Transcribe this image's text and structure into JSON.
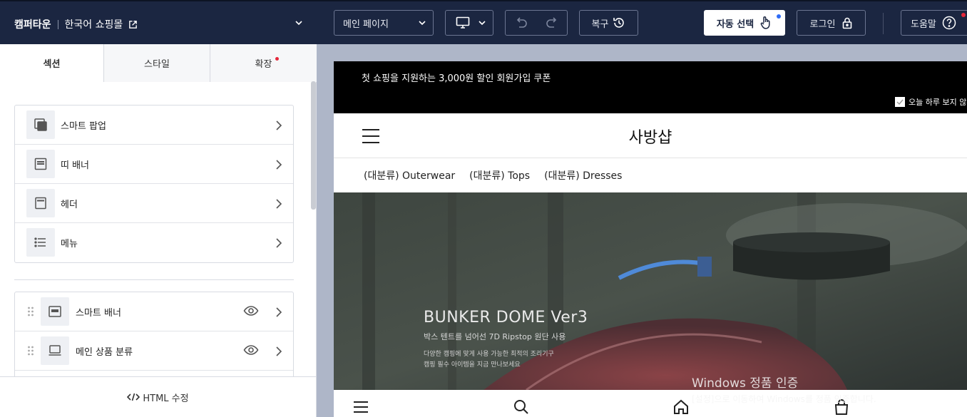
{
  "topbar": {
    "brand_name": "캠퍼타운",
    "mall_name": "한국어 쇼핑몰",
    "page_select": "메인 페이지",
    "restore_label": "복구",
    "auto_select_label": "자동 선택",
    "login_label": "로그인",
    "help_label": "도움말"
  },
  "panel": {
    "tabs": [
      {
        "label": "섹션"
      },
      {
        "label": "스타일"
      },
      {
        "label": "확장"
      }
    ],
    "fixed_sections": [
      {
        "label": "스마트 팝업",
        "icon": "popup-icon"
      },
      {
        "label": "띠 배너",
        "icon": "strip-banner-icon"
      },
      {
        "label": "헤더",
        "icon": "header-icon"
      },
      {
        "label": "메뉴",
        "icon": "menu-list-icon"
      }
    ],
    "sections": [
      {
        "label": "스마트 배너",
        "icon": "banner-icon"
      },
      {
        "label": "메인 상품 분류",
        "icon": "monitor-icon"
      }
    ],
    "html_edit_label": "HTML 수정"
  },
  "preview": {
    "promo_text": "첫 쇼핑을 지원하는 3,000원 할인 회원가입 쿠폰",
    "hide_today_label": "오늘 하루 보지 않",
    "shop_title": "사방샵",
    "nav_items": [
      "(대분류) Outerwear",
      "(대분류) Tops",
      "(대분류) Dresses"
    ],
    "hero": {
      "title": "BUNKER DOME Ver3",
      "subtitle": "박스 텐트를 넘어선 7D Ripstop 원단 사용",
      "desc_line1": "다양한 캠핑에 맞게 사용 가능한 최적의 조리기구",
      "desc_line2": "캠핑 필수 아이템을 지금 만나보세요"
    }
  },
  "watermark": {
    "line1": "Windows 정품 인증",
    "line2": "[설정]으로 이동하여 Windows를 정품 인증합니다."
  }
}
